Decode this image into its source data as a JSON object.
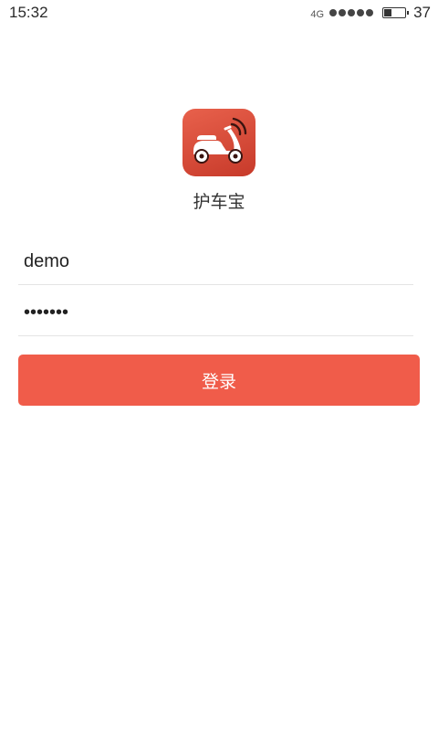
{
  "status_bar": {
    "time": "15:32",
    "network_type": "4G",
    "signal_bars": 5,
    "battery_level": "37",
    "battery_fraction": 0.37
  },
  "app": {
    "name": "护车宝",
    "icon": "scooter-icon",
    "brand_color": "#f05c4a"
  },
  "login_form": {
    "username_value": "demo",
    "password_value": "1234567",
    "submit_label": "登录"
  }
}
